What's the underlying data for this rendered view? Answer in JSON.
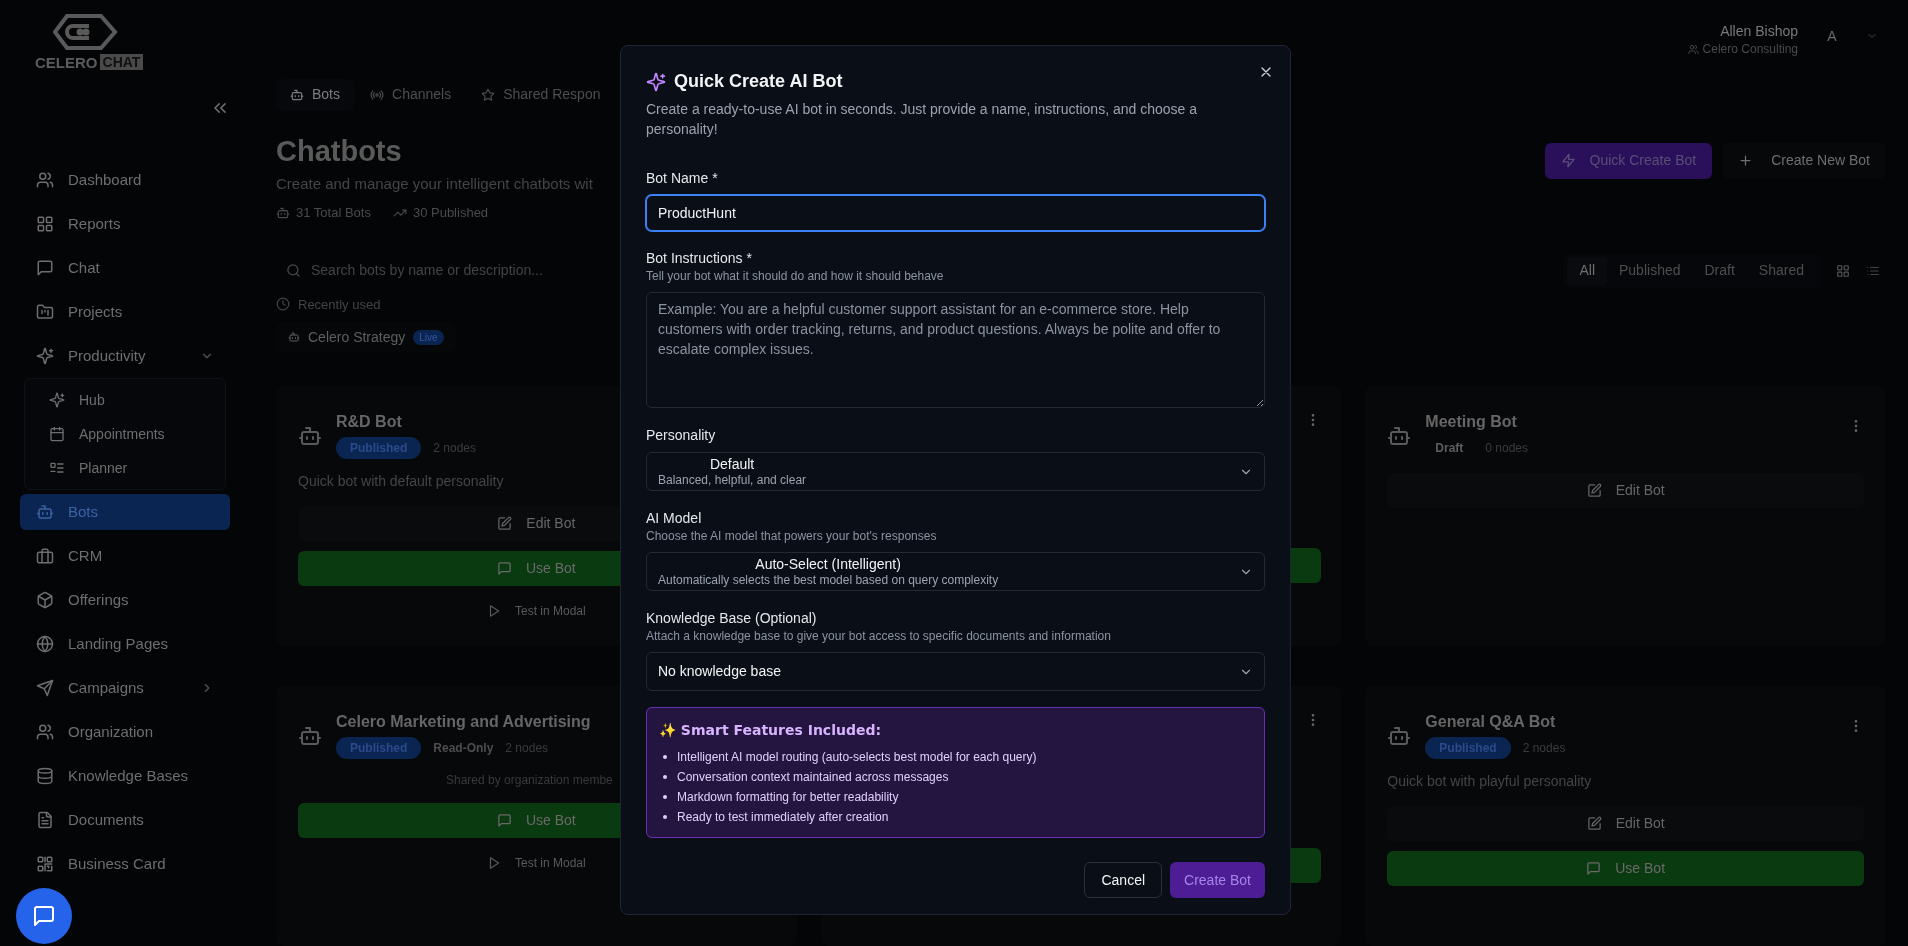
{
  "logo": {
    "word_1": "CELERO",
    "word_2": "CHAT"
  },
  "user": {
    "name": "Allen Bishop",
    "organization": "Celero Consulting",
    "avatar_initial": "A"
  },
  "sidebar": {
    "items": [
      {
        "kind": "link",
        "label": "Dashboard",
        "selected": false
      },
      {
        "kind": "link",
        "label": "Reports",
        "selected": false
      },
      {
        "kind": "link",
        "label": "Chat",
        "selected": false
      },
      {
        "kind": "link",
        "label": "Projects",
        "selected": false
      },
      {
        "kind": "group",
        "label": "Productivity",
        "selected": false,
        "expanded": true,
        "children": [
          {
            "label": "Hub",
            "selected": false
          },
          {
            "label": "Appointments",
            "selected": false
          },
          {
            "label": "Planner",
            "selected": false
          }
        ]
      },
      {
        "kind": "link",
        "label": "Bots",
        "selected": true
      },
      {
        "kind": "link",
        "label": "CRM",
        "selected": false
      },
      {
        "kind": "link",
        "label": "Offerings",
        "selected": false
      },
      {
        "kind": "link",
        "label": "Landing Pages",
        "selected": false
      },
      {
        "kind": "group",
        "label": "Campaigns",
        "selected": false,
        "expanded": false
      },
      {
        "kind": "link",
        "label": "Organization",
        "selected": false
      },
      {
        "kind": "link",
        "label": "Knowledge Bases",
        "selected": false
      },
      {
        "kind": "link",
        "label": "Documents",
        "selected": false
      },
      {
        "kind": "link",
        "label": "Business Card",
        "selected": false
      }
    ]
  },
  "tabs": [
    {
      "label": "Bots",
      "selected": true
    },
    {
      "label": "Channels",
      "selected": false
    },
    {
      "label": "Shared Respon",
      "selected": false
    }
  ],
  "heading": "Chatbots",
  "subtitle": "Create and manage your intelligent chatbots wit",
  "stats": [
    "31 Total Bots",
    "30 Published"
  ],
  "actions": [
    {
      "kind": "quick",
      "label": "Quick Create Bot"
    },
    {
      "kind": "new",
      "label": "Create New Bot"
    }
  ],
  "search": {
    "placeholder": "Search bots by name or description..."
  },
  "filters": [
    {
      "label": "All",
      "selected": true
    },
    {
      "label": "Published",
      "selected": false
    },
    {
      "label": "Draft",
      "selected": false
    },
    {
      "label": "Shared",
      "selected": false
    }
  ],
  "recent": {
    "label": "Recently used",
    "items": [
      {
        "name": "Celero Strategy",
        "badge": "Live"
      }
    ]
  },
  "cards": [
    {
      "kind": "bot",
      "title": "R&D Bot",
      "status": {
        "label": "Published",
        "kind": "published"
      },
      "nodes": "2 nodes",
      "description": "Quick bot with default personality",
      "actions": [
        {
          "kind": "edit",
          "label": "Edit Bot"
        },
        {
          "kind": "use",
          "label": "Use Bot"
        },
        {
          "kind": "test",
          "label": "Test in Modal"
        }
      ]
    },
    {
      "kind": "covered"
    },
    {
      "kind": "bot",
      "title": "Meeting Bot",
      "status": {
        "label": "Draft",
        "kind": "draft"
      },
      "nodes": "0 nodes",
      "actions": [
        {
          "kind": "edit",
          "label": "Edit Bot"
        }
      ]
    },
    {
      "kind": "bot",
      "title": "Celero Marketing and Advertising",
      "status": {
        "label": "Published",
        "kind": "published"
      },
      "tags": [
        "Read-Only"
      ],
      "nodes": "2 nodes",
      "note": "Shared by organization membe",
      "actions": [
        {
          "kind": "use",
          "label": "Use Bot"
        },
        {
          "kind": "test",
          "label": "Test in Modal"
        }
      ]
    },
    {
      "kind": "covered"
    },
    {
      "kind": "bot",
      "title": "General Q&A Bot",
      "status": {
        "label": "Published",
        "kind": "published"
      },
      "nodes": "2 nodes",
      "description": "Quick bot with playful personality",
      "actions": [
        {
          "kind": "edit",
          "label": "Edit Bot"
        },
        {
          "kind": "use",
          "label": "Use Bot"
        }
      ]
    }
  ],
  "modal": {
    "title": "Quick Create AI Bot",
    "description": "Create a ready-to-use AI bot in seconds. Just provide a name, instructions, and choose a personality!",
    "fields": [
      {
        "kind": "text",
        "label": "Bot Name *",
        "value": "ProductHunt",
        "focused": true
      },
      {
        "kind": "textarea",
        "label": "Bot Instructions *",
        "hint": "Tell your bot what it should do and how it should behave",
        "placeholder": "Example: You are a helpful customer support assistant for an e-commerce store. Help customers with order tracking, returns, and product questions. Always be polite and offer to escalate complex issues.",
        "focused": false
      },
      {
        "kind": "select",
        "label": "Personality",
        "value": "Default",
        "description": "Balanced, helpful, and clear"
      },
      {
        "kind": "select",
        "label": "AI Model",
        "hint": "Choose the AI model that powers your bot's responses",
        "value": "Auto-Select (Intelligent)",
        "description": "Automatically selects the best model based on query complexity"
      },
      {
        "kind": "select",
        "label": "Knowledge Base (Optional)",
        "hint": "Attach a knowledge base to give your bot access to specific documents and information",
        "value": "No knowledge base"
      }
    ],
    "features": {
      "title": "✨ Smart Features Included:",
      "items": [
        "Intelligent AI model routing (auto-selects best model for each query)",
        "Conversation context maintained across messages",
        "Markdown formatting for better readability",
        "Ready to test immediately after creation"
      ]
    },
    "buttons": [
      {
        "kind": "cancel",
        "label": "Cancel",
        "disabled": false
      },
      {
        "kind": "submit",
        "label": "Create Bot",
        "disabled": true
      }
    ]
  }
}
